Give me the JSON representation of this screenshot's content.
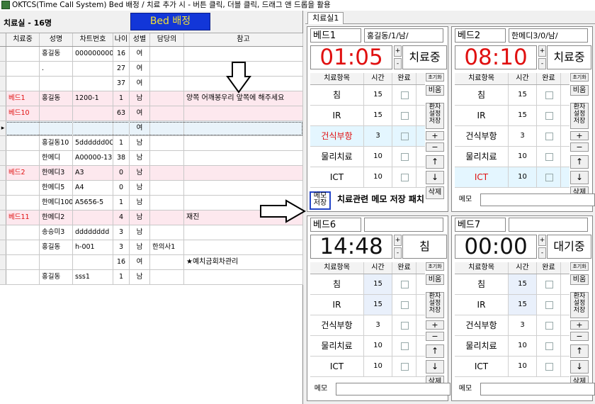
{
  "window": {
    "title": "OKTCS(Time Call System)  Bed 배정 / 치료 추가 시 - 버튼 클릭, 더블 클릭, 드래그 앤 드롭을 활용"
  },
  "left": {
    "count_label": "치료실 - 16명",
    "bed_button": "Bed 배정",
    "columns": [
      "치료중",
      "성명",
      "차트번호",
      "나이",
      "성별",
      "담당의",
      "참고"
    ],
    "rows": [
      {
        "bed": "",
        "name": "홍길동",
        "chart": "000000000",
        "age": "16",
        "sex": "여",
        "doctor": "",
        "note": ""
      },
      {
        "bed": "",
        "name": ".",
        "chart": "",
        "age": "27",
        "sex": "여",
        "doctor": "",
        "note": ""
      },
      {
        "bed": "",
        "name": "",
        "chart": "",
        "age": "37",
        "sex": "여",
        "doctor": "",
        "note": ""
      },
      {
        "bed": "베드1",
        "name": "홍길동",
        "chart": "1200-1",
        "age": "1",
        "sex": "남",
        "doctor": "",
        "note": "양쪽 어깨봉우리 앞쪽에 해주세요"
      },
      {
        "bed": "베드10",
        "name": "",
        "chart": "",
        "age": "63",
        "sex": "여",
        "doctor": "",
        "note": ""
      },
      {
        "bed": "",
        "name": "",
        "chart": "",
        "age": "",
        "sex": "여",
        "doctor": "",
        "note": ""
      },
      {
        "bed": "",
        "name": "홍길동10",
        "chart": "5dddddd0C",
        "age": "1",
        "sex": "남",
        "doctor": "",
        "note": ""
      },
      {
        "bed": "",
        "name": "한메디",
        "chart": "A00000-13",
        "age": "38",
        "sex": "남",
        "doctor": "",
        "note": ""
      },
      {
        "bed": "베드2",
        "name": "한메디3",
        "chart": "A3",
        "age": "0",
        "sex": "남",
        "doctor": "",
        "note": ""
      },
      {
        "bed": "",
        "name": "한메디5",
        "chart": "A4",
        "age": "0",
        "sex": "남",
        "doctor": "",
        "note": ""
      },
      {
        "bed": "",
        "name": "한메디100",
        "chart": "A5656-5",
        "age": "1",
        "sex": "남",
        "doctor": "",
        "note": ""
      },
      {
        "bed": "베드11",
        "name": "한메디2",
        "chart": "",
        "age": "4",
        "sex": "남",
        "doctor": "",
        "note": "재진"
      },
      {
        "bed": "",
        "name": "송승미3",
        "chart": "dddddddd",
        "age": "3",
        "sex": "남",
        "doctor": "",
        "note": ""
      },
      {
        "bed": "",
        "name": "홍길동",
        "chart": "h-001",
        "age": "3",
        "sex": "남",
        "doctor": "한의사1",
        "note": ""
      },
      {
        "bed": "",
        "name": "",
        "chart": "",
        "age": "16",
        "sex": "여",
        "doctor": "",
        "note": "★예치금회차관리"
      },
      {
        "bed": "",
        "name": "홍길동",
        "chart": "sss1",
        "age": "1",
        "sex": "남",
        "doctor": "",
        "note": ""
      }
    ]
  },
  "tab": {
    "label": "치료실1"
  },
  "beds": [
    {
      "title": "베드1",
      "patient": "홍길동/1/남/",
      "time": "01:05",
      "status": "치료중",
      "time_color": "#e01010",
      "items": [
        {
          "name": "침",
          "time": "15"
        },
        {
          "name": "IR",
          "time": "15"
        },
        {
          "name": "건식부항",
          "time": "3",
          "red": true
        },
        {
          "name": "물리치료",
          "time": "10"
        },
        {
          "name": "ICT",
          "time": "10"
        }
      ],
      "memo_label": "메모\n저장",
      "memo": "치료관련 메모 저장 패치"
    },
    {
      "title": "베드2",
      "patient": "한메디3/0/남/",
      "time": "08:10",
      "status": "치료중",
      "time_color": "#e01010",
      "items": [
        {
          "name": "침",
          "time": "15"
        },
        {
          "name": "IR",
          "time": "15"
        },
        {
          "name": "건식부항",
          "time": "3"
        },
        {
          "name": "물리치료",
          "time": "10"
        },
        {
          "name": "ICT",
          "time": "10",
          "red": true
        }
      ],
      "memo_label": "메모",
      "memo": ""
    },
    {
      "title": "베드6",
      "patient": "",
      "time": "14:48",
      "status": "침",
      "time_color": "#111111",
      "items": [
        {
          "name": "침",
          "time": "15"
        },
        {
          "name": "IR",
          "time": "15"
        },
        {
          "name": "건식부항",
          "time": "3"
        },
        {
          "name": "물리치료",
          "time": "10"
        },
        {
          "name": "ICT",
          "time": "10"
        }
      ],
      "memo_label": "메모",
      "memo": ""
    },
    {
      "title": "베드7",
      "patient": "",
      "time": "00:00",
      "status": "대기중",
      "time_color": "#111111",
      "items": [
        {
          "name": "침",
          "time": "15"
        },
        {
          "name": "IR",
          "time": "15"
        },
        {
          "name": "건식부항",
          "time": "3"
        },
        {
          "name": "물리치료",
          "time": "10"
        },
        {
          "name": "ICT",
          "time": "10"
        }
      ],
      "memo_label": "메모",
      "memo": ""
    }
  ],
  "table_headers": {
    "item": "치료항목",
    "time": "시간",
    "done": "완료"
  },
  "side_buttons": {
    "reset": "초기화",
    "empty": "비움",
    "save_setting": "환자\n설정\n저장",
    "plus": "+",
    "minus": "−",
    "up": "↑",
    "down": "↓",
    "delete": "삭제"
  },
  "spin": {
    "up": "+",
    "down": "-"
  }
}
